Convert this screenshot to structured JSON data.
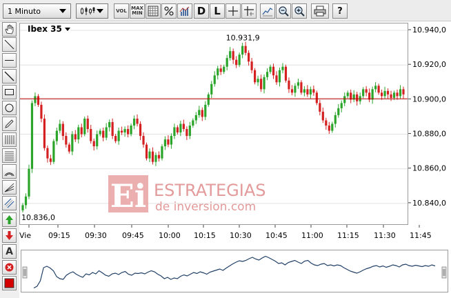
{
  "toolbar": {
    "timeframe": "1 Minuto",
    "vol_label": "VOL",
    "maxmin_label_top": "MAX",
    "maxmin_label_bottom": "MIN",
    "d_label": "D",
    "l_label": "L"
  },
  "instrument": "Ibex 35",
  "watermark": {
    "logo_letters": "Ei",
    "line1": "ESTRATEGIAS",
    "line2": "de inversion.com"
  },
  "colors": {
    "up": "#2aa52a",
    "down": "#d42020",
    "reference_line": "#c00000",
    "navigator": "#1f3f66",
    "watermark": "#e8a0a0"
  },
  "annotations": {
    "high_label": "10.931,9",
    "low_label": "10.836,0"
  },
  "chart_data": {
    "type": "candlestick",
    "y_ticks": [
      "10.940,0",
      "10.920,0",
      "10.900,0",
      "10.880,0",
      "10.860,0",
      "10.840,0"
    ],
    "y_tick_values": [
      10940,
      10920,
      10900,
      10880,
      10860,
      10840
    ],
    "x_ticks": [
      "Vie",
      "09:15",
      "09:30",
      "09:45",
      "10:00",
      "10:15",
      "10:30",
      "10:45",
      "11:00",
      "11:15",
      "11:30",
      "11:45"
    ],
    "ylim": [
      10828,
      10944
    ],
    "reference_level": 10900.5,
    "high": 10931.9,
    "low": 10836.0,
    "grid": true,
    "closes": [
      10839,
      10844,
      10860,
      10898,
      10902,
      10897,
      10889,
      10872,
      10866,
      10864,
      10876,
      10882,
      10886,
      10879,
      10874,
      10870,
      10880,
      10877,
      10884,
      10880,
      10889,
      10883,
      10876,
      10873,
      10880,
      10882,
      10878,
      10884,
      10887,
      10879,
      10876,
      10882,
      10881,
      10883,
      10880,
      10885,
      10889,
      10886,
      10879,
      10874,
      10866,
      10870,
      10864,
      10868,
      10866,
      10873,
      10877,
      10874,
      10879,
      10884,
      10881,
      10886,
      10883,
      10879,
      10885,
      10888,
      10891,
      10894,
      10890,
      10897,
      10903,
      10909,
      10914,
      10918,
      10916,
      10919,
      10924,
      10928,
      10923,
      10920,
      10926,
      10931,
      10927,
      10922,
      10917,
      10910,
      10912,
      10906,
      10913,
      10916,
      10919,
      10914,
      10910,
      10917,
      10919,
      10911,
      10906,
      10904,
      10908,
      10910,
      10904,
      10906,
      10903,
      10906,
      10904,
      10898,
      10893,
      10888,
      10885,
      10882,
      10886,
      10891,
      10895,
      10898,
      10902,
      10904,
      10900,
      10903,
      10899,
      10902,
      10906,
      10904,
      10900,
      10906,
      10908,
      10904,
      10902,
      10905,
      10903,
      10901,
      10904,
      10902,
      10906,
      10903
    ]
  }
}
